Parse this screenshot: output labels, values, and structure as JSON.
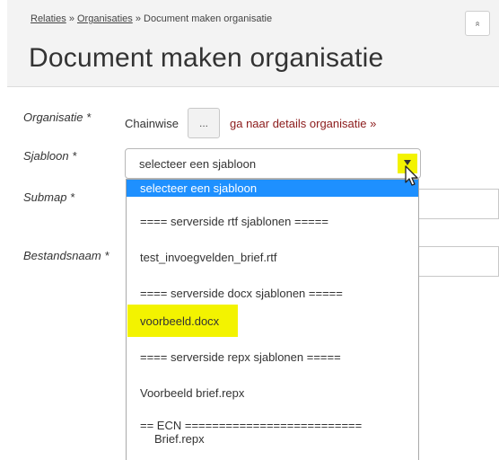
{
  "breadcrumb": {
    "relaties": "Relaties",
    "organisaties": "Organisaties",
    "current": "Document maken organisatie",
    "separator": "»"
  },
  "header": {
    "title": "Document maken organisatie",
    "collapse_icon": "double-chevron-up-icon",
    "collapse_glyph": "»"
  },
  "form": {
    "organisatie_label": "Organisatie *",
    "organisatie_value": "Chainwise",
    "dots_label": "...",
    "details_link": "ga naar details organisatie »",
    "sjabloon_label": "Sjabloon *",
    "sjabloon_value": "selecteer een sjabloon",
    "submap_label": "Submap *",
    "bestandsnaam_label": "Bestandsnaam *"
  },
  "dropdown": {
    "options": [
      "selecteer een sjabloon",
      "==== serverside rtf sjablonen =====",
      "test_invoegvelden_brief.rtf",
      "==== serverside docx sjablonen =====",
      "voorbeeld.docx",
      "==== serverside repx sjablonen =====",
      "Voorbeeld brief.repx",
      "== ECN ==========================",
      "Brief.repx"
    ],
    "selected_index": 0,
    "highlight_index": 4
  },
  "colors": {
    "highlight": "#f3f300",
    "selected": "#1e90ff",
    "link": "#8b1a1a"
  }
}
